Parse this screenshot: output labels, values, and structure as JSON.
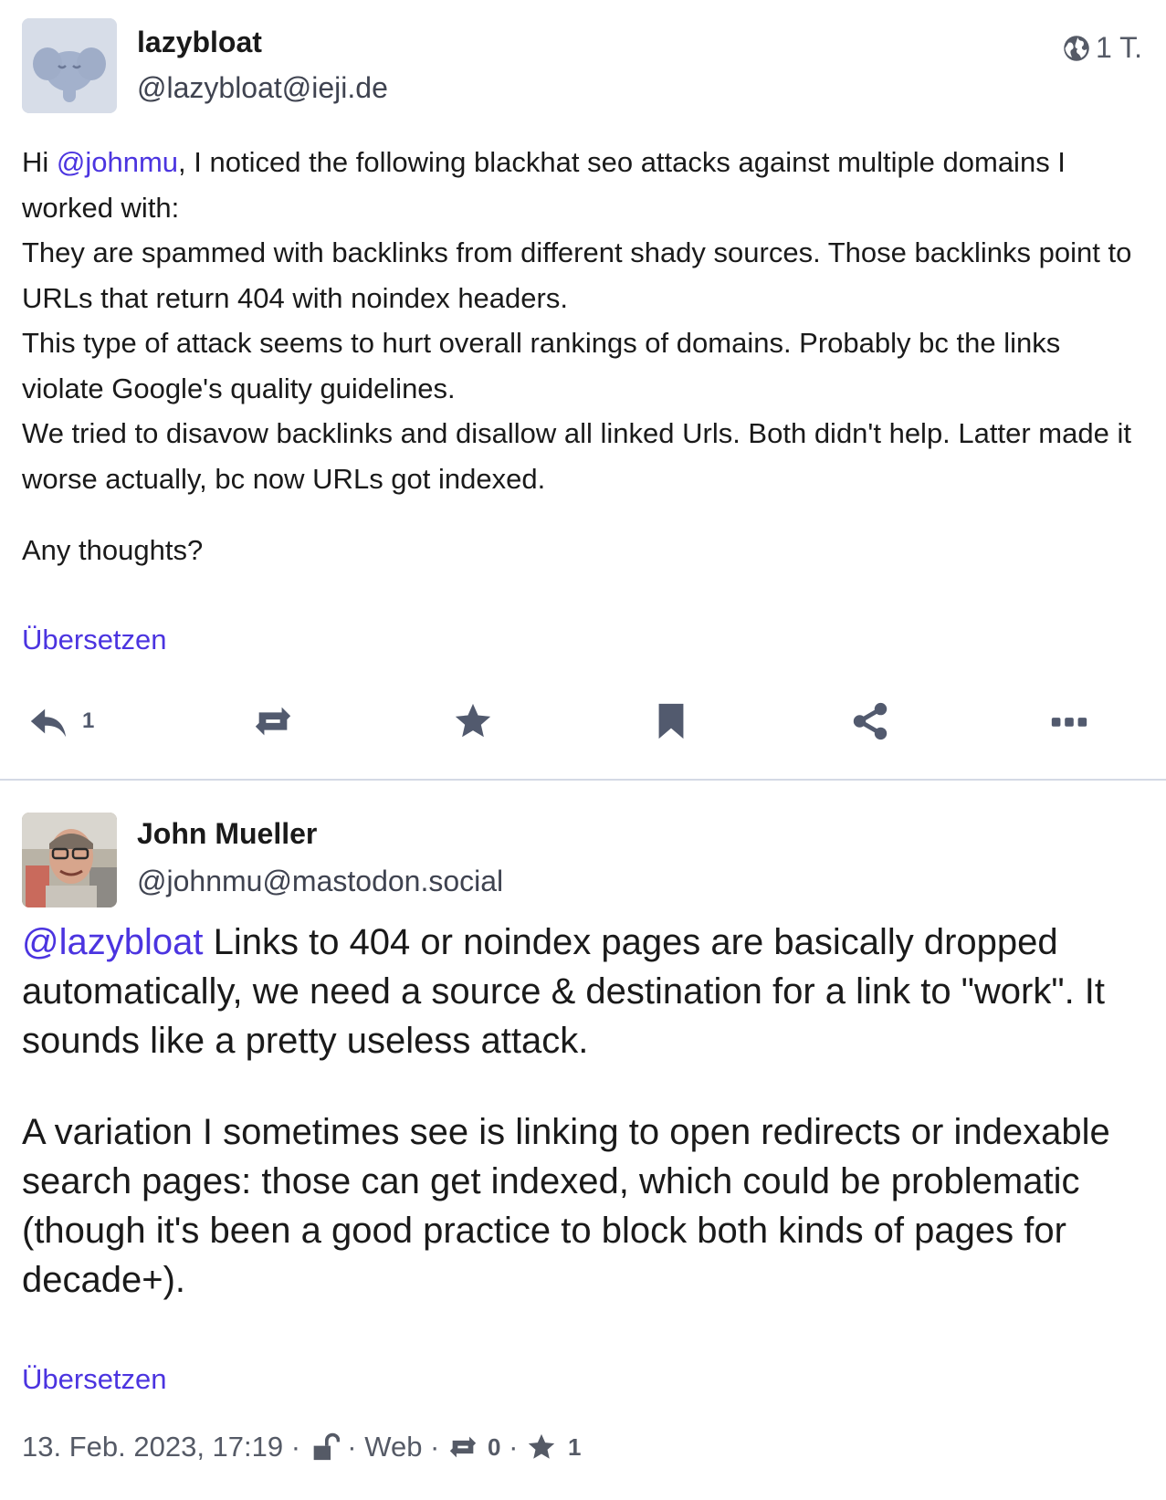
{
  "status1": {
    "display_name": "lazybloat",
    "acct": "@lazybloat@ieji.de",
    "visibility_icon": "globe-icon",
    "relative_time": "1 T.",
    "mention": "@johnmu",
    "content_line_1_rest": ", I noticed the following blackhat seo attacks against multiple domains I worked with:",
    "content_rest": "They are spammed with backlinks from different shady sources. Those backlinks point to URLs that return 404 with noindex headers.\nThis type of attack seems to hurt overall rankings of domains. Probably bc the links violate Google's quality guidelines.\nWe tried to disavow backlinks and disallow all linked Urls. Both didn't help. Latter made it worse actually, bc now URLs got indexed.",
    "content_greeting": "Hi ",
    "content_question": "Any thoughts?",
    "translate_label": "Übersetzen",
    "actions": {
      "reply_icon": "reply-icon",
      "reply_count": "1",
      "boost_icon": "boost-icon",
      "favourite_icon": "star-icon",
      "bookmark_icon": "bookmark-icon",
      "share_icon": "share-icon",
      "more_icon": "more-icon"
    }
  },
  "status2": {
    "display_name": "John Mueller",
    "acct": "@johnmu@mastodon.social",
    "mention": "@lazybloat",
    "paragraph_1_rest": " Links to 404 or noindex pages are basically dropped automatically, we need a source & destination for a link to \"work\". It sounds like a pretty useless attack.",
    "paragraph_2": "A variation I sometimes see is linking to open redirects or indexable search pages: those can get indexed, which could be problematic (though it's been a good practice to block both kinds of pages for decade+).",
    "translate_label": "Übersetzen",
    "footer": {
      "date": "13. Feb. 2023, 17:19",
      "sep": " · ",
      "visibility_icon": "unlock-icon",
      "application": "Web",
      "boost_icon": "boost-icon",
      "boost_count": "0",
      "favourite_icon": "star-icon",
      "favourite_count": "1"
    }
  },
  "colors": {
    "link": "#4b34e0",
    "icon": "#525a6e",
    "divider": "#d4d9e5"
  }
}
